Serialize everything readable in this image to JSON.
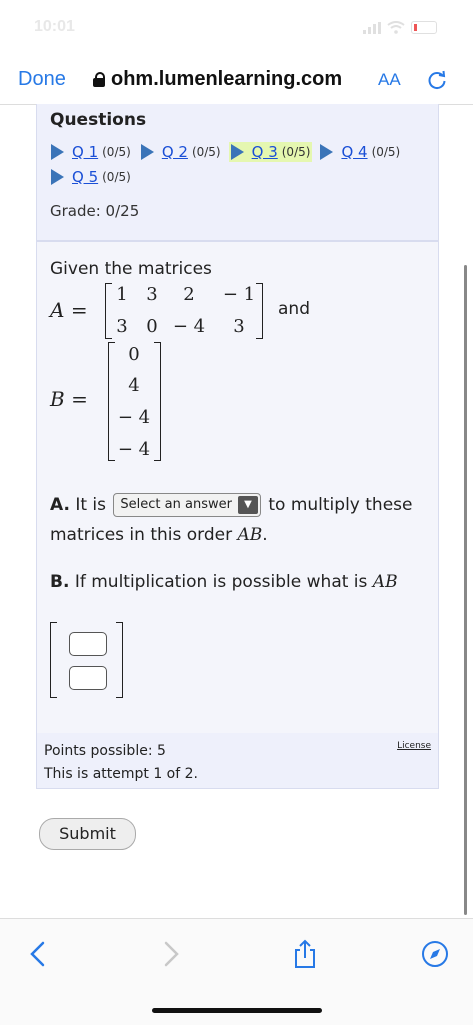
{
  "status": {
    "time": "10:01"
  },
  "nav": {
    "done": "Done",
    "url": "ohm.lumenlearning.com",
    "aa": "AA"
  },
  "questions": {
    "title": "Questions",
    "items": [
      {
        "label": "Q 1",
        "score": "(0/5)"
      },
      {
        "label": "Q 2",
        "score": "(0/5)"
      },
      {
        "label": "Q 3",
        "score": "(0/5)"
      },
      {
        "label": "Q 4",
        "score": "(0/5)"
      },
      {
        "label": "Q 5",
        "score": "(0/5)"
      }
    ],
    "grade": "Grade: 0/25"
  },
  "problem": {
    "intro": "Given the matrices",
    "a_label": "A",
    "b_label": "B",
    "eq": "=",
    "matrix_a": [
      [
        "1",
        "3",
        "2",
        "− 1"
      ],
      [
        "3",
        "0",
        "− 4",
        "3"
      ]
    ],
    "and": "and",
    "matrix_b": [
      "0",
      "4",
      "− 4",
      "− 4"
    ],
    "partA_prefix": "A.",
    "partA_it": "It is",
    "select_placeholder": "Select an answer",
    "partA_rest": "to multiply these matrices in this order",
    "partA_ab": "AB",
    "partA_end": ".",
    "partB_prefix": "B.",
    "partB_text": "If multiplication is possible what is",
    "partB_ab": "AB"
  },
  "footer": {
    "points": "Points possible: 5",
    "attempt": "This is attempt 1 of 2.",
    "license": "License"
  },
  "submit": "Submit"
}
